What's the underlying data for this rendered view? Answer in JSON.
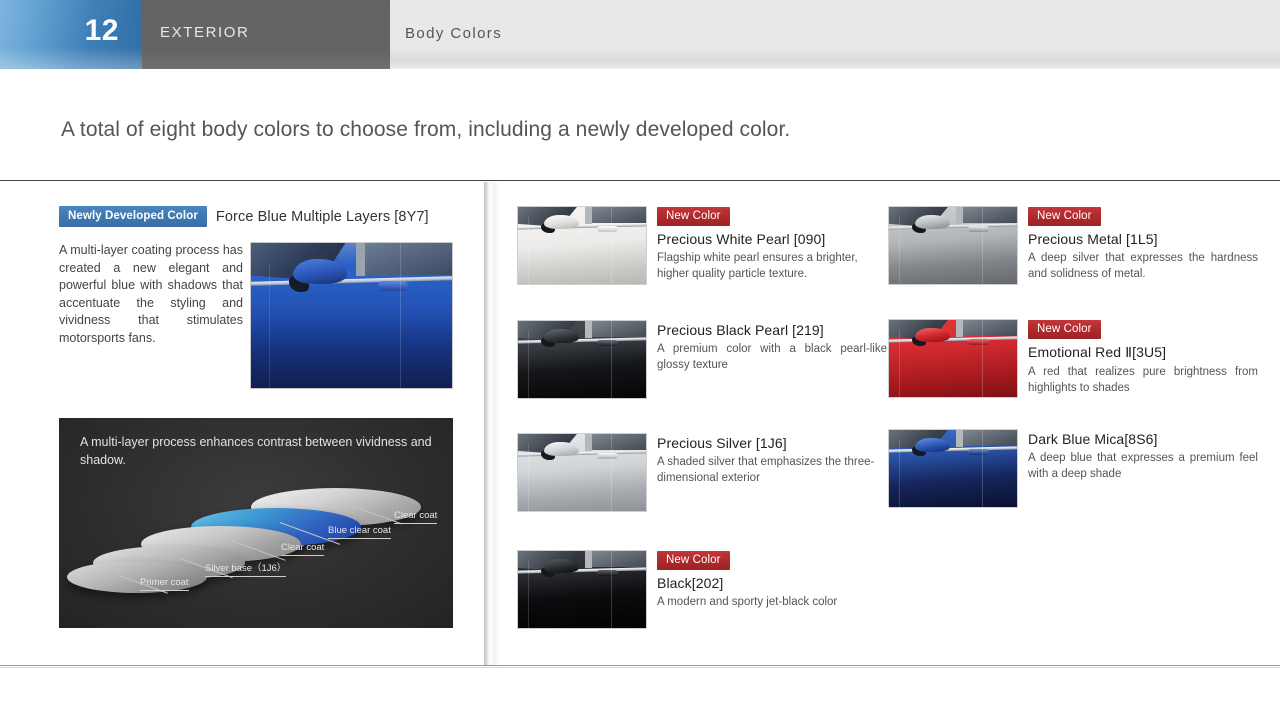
{
  "header": {
    "page_number": "12",
    "category": "EXTERIOR",
    "subtitle": "Body Colors"
  },
  "lead": "A total of eight body colors to choose from, including a newly developed color.",
  "featured": {
    "badge": "Newly Developed Color",
    "name": "Force Blue Multiple Layers [8Y7]",
    "description": "A multi-layer coating process has created a new elegant and powerful blue with shadows that accentuate the styling and vividness that stimulates motorsports fans.",
    "photo_alt": "force-blue-door-photo"
  },
  "diagram": {
    "caption": "A multi-layer process enhances contrast between vividness and shadow.",
    "layers": [
      {
        "label": "Clear coat"
      },
      {
        "label": "Blue clear coat"
      },
      {
        "label": "Clear coat"
      },
      {
        "label": "Silver base（1J6）"
      },
      {
        "label": "Primer coat"
      }
    ]
  },
  "colors": {
    "middle": [
      {
        "badge": "New Color",
        "name": "Precious White Pearl [090]",
        "description": "Flagship white pearl ensures a brighter, higher quality particle texture.",
        "justified": false,
        "swatch": "#eceae7",
        "swatch2": "#c9c7c4",
        "accent": "#d9d7d4"
      },
      {
        "badge": "",
        "name": "Precious Black Pearl [219]",
        "description": "A premium color with a black pearl-like glossy texture",
        "justified": true,
        "swatch": "#3a3d42",
        "swatch2": "#0a0b0d",
        "accent": "#2a2d33"
      },
      {
        "badge": "",
        "name": "Precious Silver [1J6]",
        "description": "A shaded silver that emphasizes the three-dimensional exterior",
        "justified": false,
        "swatch": "#d6d8da",
        "swatch2": "#9a9ea3",
        "accent": "#b8bcc0"
      },
      {
        "badge": "New Color",
        "name": "Black[202]",
        "description": "A modern and sporty jet-black color",
        "justified": false,
        "swatch": "#2e3034",
        "swatch2": "#060607",
        "accent": "#1e2024"
      }
    ],
    "right": [
      {
        "badge": "New Color",
        "name": "Precious Metal [1L5]",
        "description": "A deep silver that expresses the hardness and solidness of metal.",
        "justified": true,
        "swatch": "#b6b9bb",
        "swatch2": "#6e7276",
        "accent": "#8e9295"
      },
      {
        "badge": "New Color",
        "name": "Emotional Red Ⅱ[3U5]",
        "description": "A red that realizes pure brightness from highlights to shades",
        "justified": true,
        "swatch": "#d8262c",
        "swatch2": "#8d1115",
        "accent": "#b71a20"
      },
      {
        "badge": "",
        "name": "Dark Blue Mica[8S6]",
        "description": "A deep blue that expresses a premium feel with a deep shade",
        "justified": true,
        "swatch": "#2a53a8",
        "swatch2": "#101b3e",
        "accent": "#1b3madd"
      }
    ]
  },
  "theme": {
    "accent_blue": "#3f78b0",
    "badge_red": "#b02a2d",
    "header_grey": "#646464",
    "text_grey": "#555555",
    "rule_dark": "#444444"
  }
}
